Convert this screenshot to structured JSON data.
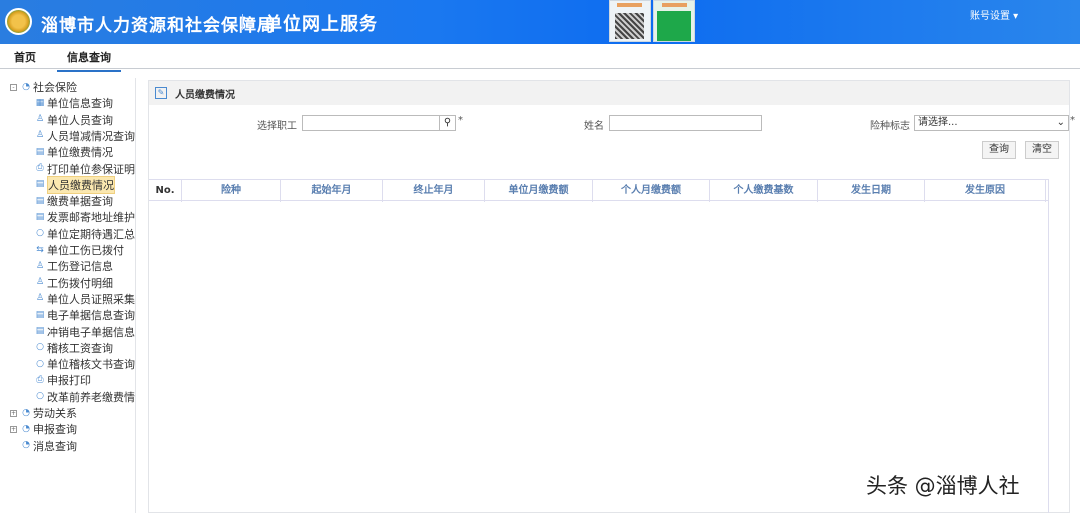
{
  "header": {
    "site_title": "淄博市人力资源和社会保障局",
    "sub_title": "单位网上服务",
    "account": "账号设置 ▾"
  },
  "tabs": [
    {
      "label": "首页"
    },
    {
      "label": "信息查询"
    }
  ],
  "sidebar": {
    "items": [
      {
        "label": "社会保险",
        "level": 0,
        "icon": "folder-icon",
        "expand": "⊟"
      },
      {
        "label": "单位信息查询",
        "level": 1,
        "icon": "org-icon"
      },
      {
        "label": "单位人员查询",
        "level": 1,
        "icon": "user-icon"
      },
      {
        "label": "人员增减情况查询",
        "level": 1,
        "icon": "user-icon"
      },
      {
        "label": "单位缴费情况",
        "level": 1,
        "icon": "form-icon"
      },
      {
        "label": "打印单位参保证明",
        "level": 1,
        "icon": "printer-icon"
      },
      {
        "label": "人员缴费情况",
        "level": 1,
        "icon": "form-icon",
        "selected": true
      },
      {
        "label": "缴费单据查询",
        "level": 1,
        "icon": "form-icon"
      },
      {
        "label": "发票邮寄地址维护",
        "level": 1,
        "icon": "form-icon"
      },
      {
        "label": "单位定期待遇汇总(",
        "level": 1,
        "icon": "search-icon"
      },
      {
        "label": "单位工伤已拨付",
        "level": 1,
        "icon": "transfer-icon"
      },
      {
        "label": "工伤登记信息",
        "level": 1,
        "icon": "user-icon"
      },
      {
        "label": "工伤拨付明细",
        "level": 1,
        "icon": "user-icon"
      },
      {
        "label": "单位人员证照采集",
        "level": 1,
        "icon": "user-icon"
      },
      {
        "label": "电子单据信息查询",
        "level": 1,
        "icon": "form-icon"
      },
      {
        "label": "冲销电子单据信息i",
        "level": 1,
        "icon": "form-icon"
      },
      {
        "label": "稽核工资查询",
        "level": 1,
        "icon": "search-icon"
      },
      {
        "label": "单位稽核文书查询",
        "level": 1,
        "icon": "search-icon"
      },
      {
        "label": "申报打印",
        "level": 1,
        "icon": "printer-icon"
      },
      {
        "label": "改革前养老缴费情",
        "level": 1,
        "icon": "search-icon"
      },
      {
        "label": "劳动关系",
        "level": 0,
        "icon": "folder-icon",
        "expand": "⊞"
      },
      {
        "label": "申报查询",
        "level": 0,
        "icon": "folder-icon",
        "expand": "⊞"
      },
      {
        "label": "消息查询",
        "level": 0,
        "icon": "folder-icon"
      }
    ]
  },
  "panel": {
    "title": "人员缴费情况",
    "select_employee_label": "选择职工",
    "select_employee_value": "",
    "required": "*",
    "name_label": "姓名",
    "name_value": "",
    "insurance_label": "险种标志",
    "insurance_value": "请选择...",
    "query_button": "查询",
    "clear_button": "清空"
  },
  "table": {
    "columns": [
      "No.",
      "险种",
      "起始年月",
      "终止年月",
      "单位月缴费额",
      "个人月缴费额",
      "个人缴费基数",
      "发生日期",
      "发生原因"
    ],
    "rows": []
  },
  "watermark": "头条 @淄博人社"
}
